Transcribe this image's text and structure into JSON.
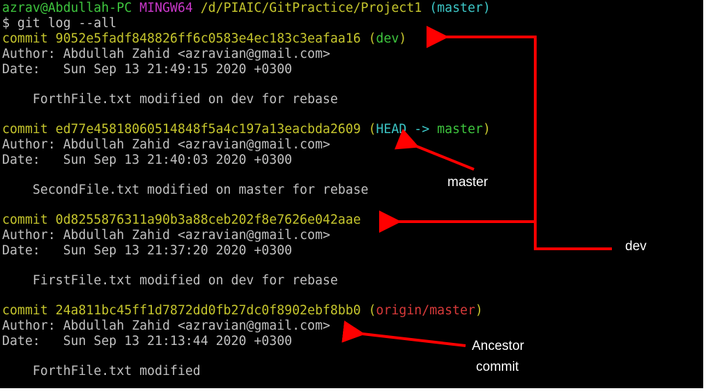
{
  "prompt": {
    "user_host": "azrav@Abdullah-PC",
    "shell": "MINGW64",
    "path": "/d/PIAIC/GitPractice/Project1",
    "branch": "(master)"
  },
  "command": "$ git log --all",
  "commits": [
    {
      "commit_line": "commit 9052e5fadf848826ff6c0583e4ec183c3eafaa16",
      "ref_open": "(",
      "ref_main": "dev",
      "ref_close": ")",
      "author": "Author: Abdullah Zahid <azravian@gmail.com>",
      "date": "Date:   Sun Sep 13 21:49:15 2020 +0300",
      "message": "    ForthFile.txt modified on dev for rebase"
    },
    {
      "commit_line": "commit ed77e45818060514848f5a4c197a13eacbda2609",
      "ref_open": "(",
      "ref_head": "HEAD -> ",
      "ref_main": "master",
      "ref_close": ")",
      "author": "Author: Abdullah Zahid <azravian@gmail.com>",
      "date": "Date:   Sun Sep 13 21:40:03 2020 +0300",
      "message": "    SecondFile.txt modified on master for rebase"
    },
    {
      "commit_line": "commit 0d8255876311a90b3a88ceb202f8e7626e042aae",
      "author": "Author: Abdullah Zahid <azravian@gmail.com>",
      "date": "Date:   Sun Sep 13 21:37:20 2020 +0300",
      "message": "    FirstFile.txt modified on dev for rebase"
    },
    {
      "commit_line": "commit 24a811bc45ff1d7872dd0fb27dc0f8902ebf8bb0",
      "ref_open": "(",
      "ref_main": "origin/master",
      "ref_close": ")",
      "author": "Author: Abdullah Zahid <azravian@gmail.com>",
      "date": "Date:   Sun Sep 13 21:13:44 2020 +0300",
      "message": "    ForthFile.txt modified"
    }
  ],
  "annotations": {
    "master": "master",
    "dev": "dev",
    "ancestor_line1": "Ancestor",
    "ancestor_line2": "commit"
  },
  "colors": {
    "background": "#000000",
    "prompt_green": "#3ec43e",
    "prompt_magenta": "#c837c8",
    "commit_yellow": "#c5c52d",
    "head_cyan": "#3cc6c6",
    "remote_red": "#d83a3a",
    "arrow_red": "#ff0000"
  }
}
